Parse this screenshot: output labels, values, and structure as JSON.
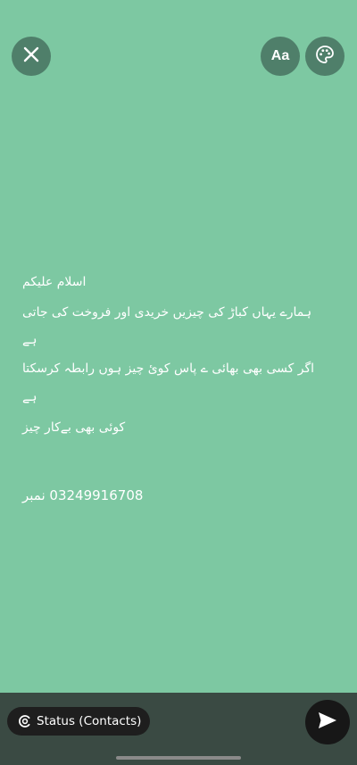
{
  "toolbar": {
    "close_icon": "close-icon",
    "font_label": "Aa",
    "palette_icon": "palette-icon"
  },
  "message": {
    "lines": [
      "اسلام علیکم",
      "ہمارے یہاں کباڑ کی چیزیں  خریدی اور فروخت  کی جاتی",
      "ہے",
      "اگر کسی بھی  بھائی ے پاس کوئ چیز  ہوں رابطہ کرسکتا",
      "ہے",
      "کوئی بھی  بےکار چیز",
      "03249916708  نمبر"
    ]
  },
  "footer": {
    "status_label": "Status (Contacts)",
    "status_icon": "status-icon",
    "send_icon": "send-icon"
  },
  "colors": {
    "background": "#7dc8a2",
    "button": "#4f7f6a",
    "footer": "#3a4a43"
  }
}
